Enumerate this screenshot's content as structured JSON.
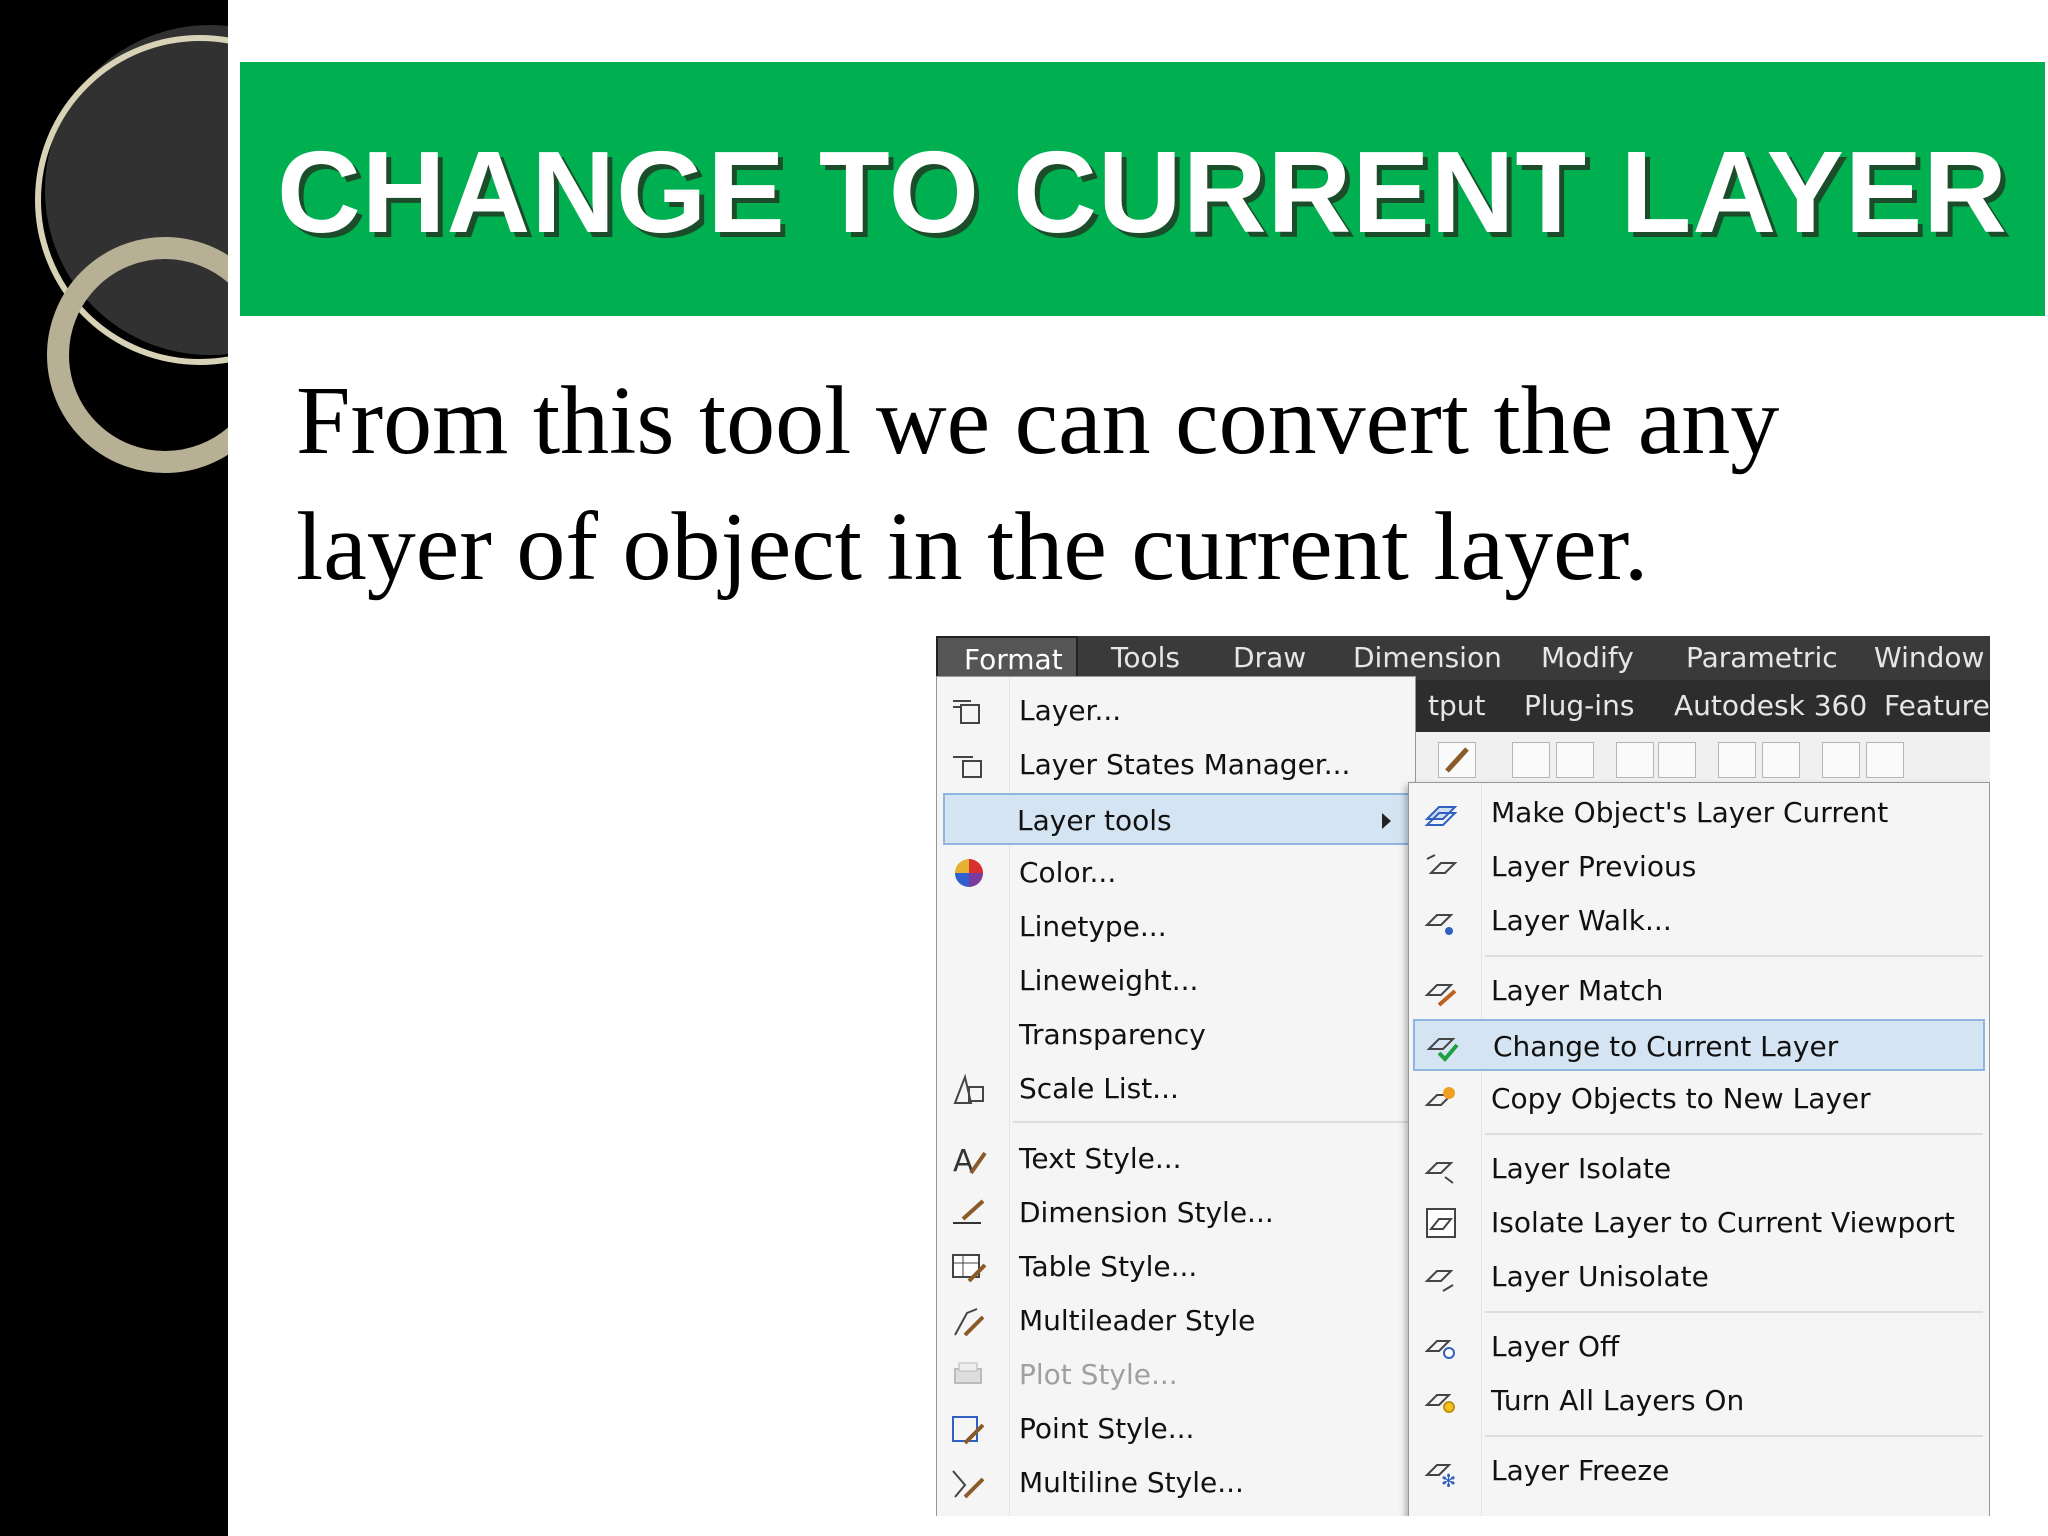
{
  "slide": {
    "title": "CHANGE TO CURRENT LAYER",
    "body_line1": "From this tool we can convert the any",
    "body_line2": "layer of object in the current layer."
  },
  "menubar": [
    "Format",
    "Tools",
    "Draw",
    "Dimension",
    "Modify",
    "Parametric",
    "Window"
  ],
  "ribbon_tabs": [
    "tput",
    "Plug-ins",
    "Autodesk 360",
    "Featured"
  ],
  "format_menu": [
    {
      "label": "Layer...",
      "icon": "layer-properties-icon"
    },
    {
      "label": "Layer States Manager...",
      "icon": "layer-states-icon"
    },
    {
      "label": "Layer tools",
      "icon": "none",
      "highlighted": true,
      "submenu": true
    },
    {
      "label": "Color...",
      "icon": "color-wheel-icon"
    },
    {
      "label": "Linetype...",
      "icon": "none"
    },
    {
      "label": "Lineweight...",
      "icon": "none"
    },
    {
      "label": "Transparency",
      "icon": "none"
    },
    {
      "label": "Scale List...",
      "icon": "scale-list-icon"
    },
    {
      "label": "Text Style...",
      "icon": "text-style-icon"
    },
    {
      "label": "Dimension Style...",
      "icon": "dimension-style-icon"
    },
    {
      "label": "Table Style...",
      "icon": "table-style-icon"
    },
    {
      "label": "Multileader Style",
      "icon": "multileader-style-icon"
    },
    {
      "label": "Plot Style...",
      "icon": "plot-style-icon",
      "disabled": true
    },
    {
      "label": "Point Style...",
      "icon": "point-style-icon"
    },
    {
      "label": "Multiline Style...",
      "icon": "multiline-style-icon"
    }
  ],
  "layer_tools_menu": [
    {
      "label": "Make Object's Layer Current",
      "icon": "make-current-icon"
    },
    {
      "label": "Layer Previous",
      "icon": "layer-previous-icon"
    },
    {
      "label": "Layer Walk...",
      "icon": "layer-walk-icon"
    },
    {
      "label": "Layer Match",
      "icon": "layer-match-icon"
    },
    {
      "label": "Change to Current Layer",
      "icon": "change-to-current-icon",
      "highlighted": true
    },
    {
      "label": "Copy Objects to New Layer",
      "icon": "copy-to-new-layer-icon"
    },
    {
      "label": "Layer Isolate",
      "icon": "layer-isolate-icon"
    },
    {
      "label": "Isolate Layer to Current Viewport",
      "icon": "isolate-viewport-icon"
    },
    {
      "label": "Layer Unisolate",
      "icon": "layer-unisolate-icon"
    },
    {
      "label": "Layer Off",
      "icon": "layer-off-icon"
    },
    {
      "label": "Turn All Layers On",
      "icon": "layers-on-icon"
    },
    {
      "label": "Layer Freeze",
      "icon": "layer-freeze-icon"
    }
  ],
  "colors": {
    "banner": "#00b050",
    "highlight": "#d5e4f3",
    "menubar": "#3a3a3a"
  }
}
